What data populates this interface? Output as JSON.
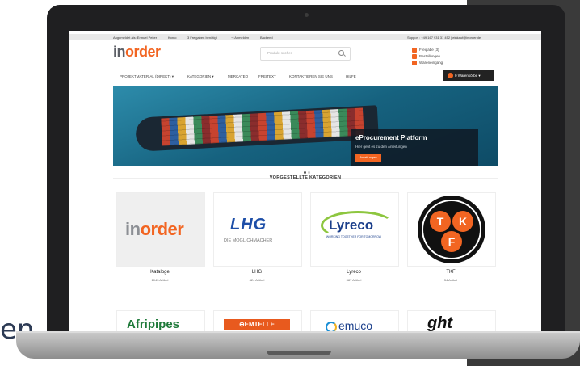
{
  "stray_text": "en",
  "topbar": {
    "user": "Angemeldet als: Ermuel Peiter",
    "link1": "Konto",
    "link2": "3 Freigaben benötigt",
    "logout": "Abmelden",
    "backend": "Backend",
    "support": "Support : +49 167 931 31 452 | einkauf@inorder.de"
  },
  "logo": {
    "part1": "in",
    "part2": "order"
  },
  "search": {
    "placeholder": "Produkt suchen"
  },
  "quick_links": [
    "Freigabe (3)",
    "Bestellungen",
    "Wareneingang"
  ],
  "nav": [
    "PROJEKTMATERIAL (DIREKT) ▾",
    "KATEGORIEN ▾",
    "MERCATEO",
    "FREITEXT",
    "KONTAKTIEREN SIE UNS",
    "HILFE"
  ],
  "cart": {
    "count": "0",
    "label": "0 Warenkörbe ▾"
  },
  "hero": {
    "title": "eProcurement Platform",
    "subtitle": "Hier geht es zu den Anleitungen",
    "button": "Anleitungen"
  },
  "section_title": "VORGESTELLTE KATEGORIEN",
  "categories": [
    {
      "name": "Kataloge",
      "count": "1043 Artikel",
      "logo": "inorder"
    },
    {
      "name": "LHG",
      "count": "424 Artikel",
      "logo": "LHG",
      "tagline": "DIE MÖGLICHMACHER"
    },
    {
      "name": "Lyreco",
      "count": "387 Artikel",
      "logo": "Lyreco",
      "tagline": "WORKING TOGETHER FOR TOMORROW"
    },
    {
      "name": "TKF",
      "count": "34 Artikel",
      "letters": [
        "T",
        "K",
        "F"
      ]
    }
  ],
  "categories_row2": [
    {
      "logo": "Afripipes"
    },
    {
      "logo": "EMTELLE"
    },
    {
      "logo": "emuco"
    },
    {
      "logo": "ght"
    }
  ],
  "colors": {
    "accent": "#f26522",
    "logo_gray": "#5c5f66",
    "lhg_blue": "#1e4fa8",
    "lyreco_blue": "#1b3f8b",
    "lyreco_green": "#8dc63f",
    "afripipes_green": "#1f7a3a"
  }
}
